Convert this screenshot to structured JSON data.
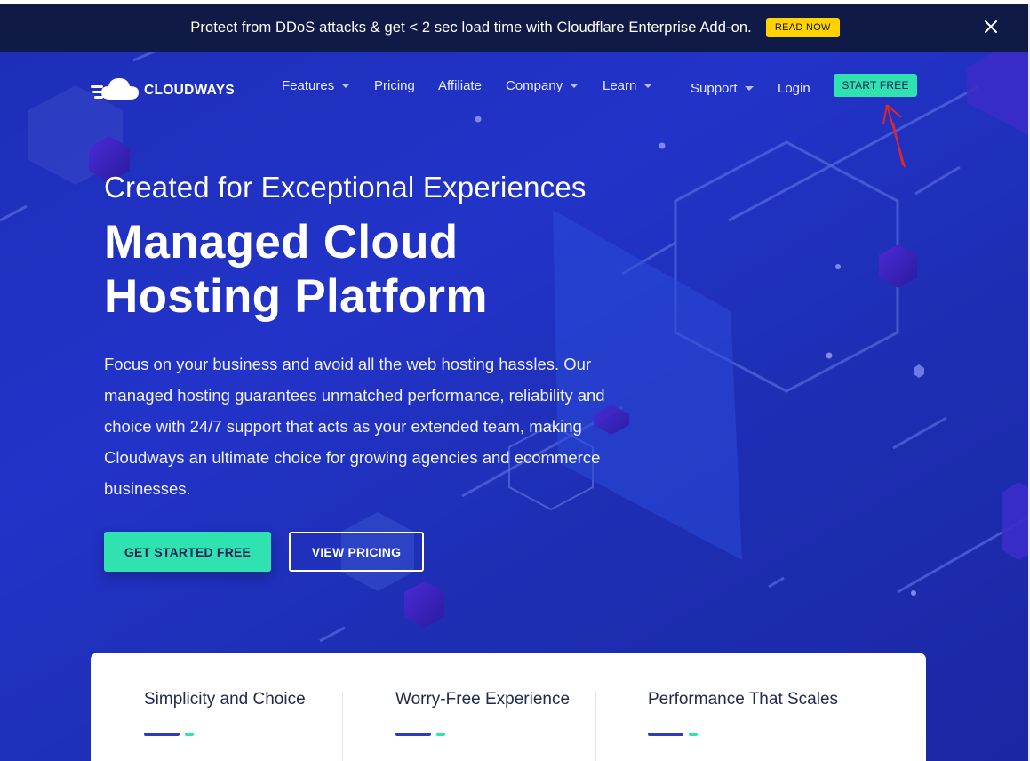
{
  "banner": {
    "text": "Protect from DDoS attacks & get < 2 sec load time with Cloudflare Enterprise Add-on.",
    "cta": "READ NOW",
    "close_icon": "close-icon"
  },
  "nav": {
    "logo_text": "CLOUDWAYS",
    "logo_icon": "cloud-logo-icon",
    "items": [
      {
        "label": "Features",
        "dropdown": true
      },
      {
        "label": "Pricing",
        "dropdown": false
      },
      {
        "label": "Affiliate",
        "dropdown": false
      },
      {
        "label": "Company",
        "dropdown": true
      },
      {
        "label": "Learn",
        "dropdown": true
      }
    ],
    "support": "Support",
    "login": "Login",
    "start_free": "START FREE"
  },
  "hero": {
    "kicker": "Created for Exceptional Experiences",
    "headline_line1": "Managed Cloud",
    "headline_line2": "Hosting Platform",
    "description": "Focus on your business and avoid all the web hosting hassles. Our managed hosting guarantees unmatched performance, reliability and choice with 24/7 support that acts as your extended team, making Cloudways an ultimate choice for growing agencies and ecommerce businesses.",
    "primary_cta": "GET STARTED FREE",
    "secondary_cta": "VIEW PRICING"
  },
  "features": [
    {
      "title": "Simplicity and Choice"
    },
    {
      "title": "Worry-Free Experience"
    },
    {
      "title": "Performance That Scales"
    }
  ],
  "colors": {
    "banner_bg": "#101a47",
    "hero_bg": "#1f30bd",
    "accent_green": "#2fe2b0",
    "read_now_yellow": "#ffd200",
    "annotation_arrow": "#e0262b"
  }
}
